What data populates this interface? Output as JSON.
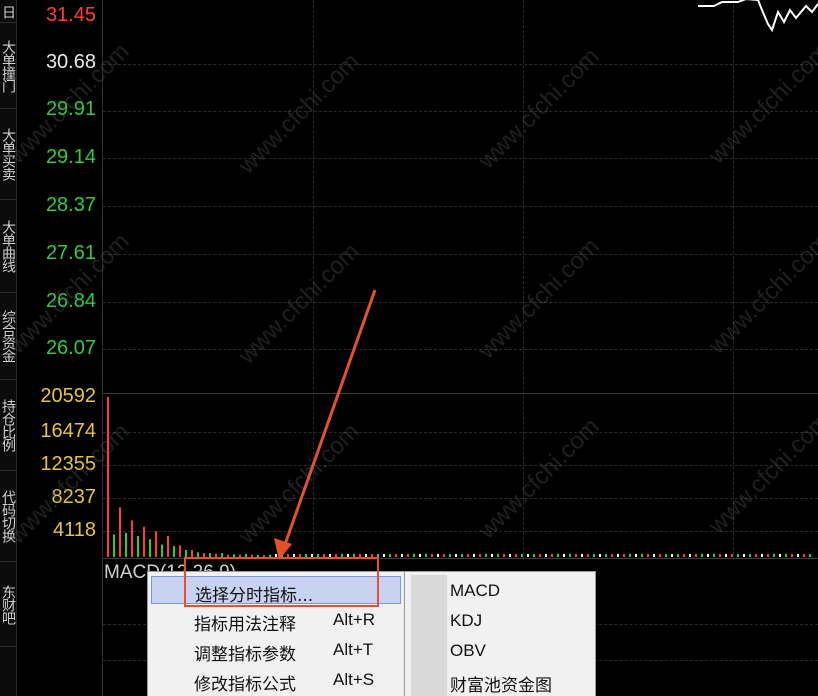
{
  "side_tabs": [
    "日",
    "大单撞门",
    "大单买卖",
    "大单曲线",
    "综合资金",
    "持仓比例",
    "代码切换",
    "东财吧"
  ],
  "price_axis": {
    "labels": [
      {
        "text": "31.45",
        "color": "#ff3b3b"
      },
      {
        "text": "30.68",
        "color": "#e8e8e8"
      },
      {
        "text": "29.91",
        "color": "#2ecc40"
      },
      {
        "text": "29.14",
        "color": "#2ecc40"
      },
      {
        "text": "28.37",
        "color": "#2ecc40"
      },
      {
        "text": "27.61",
        "color": "#2ecc40"
      },
      {
        "text": "26.84",
        "color": "#2ecc40"
      },
      {
        "text": "26.07",
        "color": "#2ecc40"
      }
    ]
  },
  "volume_axis": {
    "labels": [
      "20592",
      "16474",
      "12355",
      "8237",
      "4118"
    ]
  },
  "indicator_label": "MACD(12,26,9)",
  "watermark_text": "www.cfchi.com",
  "context_menu": {
    "items": [
      {
        "label": "选择分时指标...",
        "shortcut": "",
        "selected": true
      },
      {
        "label": "指标用法注释",
        "shortcut": "Alt+R",
        "selected": false
      },
      {
        "label": "调整指标参数",
        "shortcut": "Alt+T",
        "selected": false
      },
      {
        "label": "修改指标公式",
        "shortcut": "Alt+S",
        "selected": false
      }
    ]
  },
  "submenu": {
    "items": [
      "MACD",
      "KDJ",
      "OBV",
      "财富池资金图"
    ]
  },
  "colors": {
    "up": "#ff3b3b",
    "down": "#2ecc40",
    "volume_axis": "#e7c244",
    "annotation": "#e4522a"
  },
  "chart_data": {
    "type": "bar",
    "volume_bars": [
      20592,
      2900,
      6400,
      3100,
      4700,
      2700,
      3900,
      2300,
      3300,
      1600,
      2700,
      1400,
      1500,
      900,
      900,
      600,
      500,
      500,
      400,
      500,
      300,
      350,
      300,
      400,
      300,
      250,
      250,
      300
    ]
  }
}
